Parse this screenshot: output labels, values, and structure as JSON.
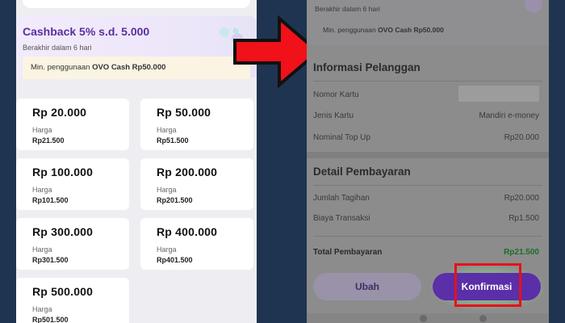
{
  "left": {
    "promo": {
      "title": "Cashback 5% s.d. 5.000",
      "subtitle": "Berakhir dalam 6 hari",
      "min_prefix": "Min. penggunaan ",
      "min_bold": "OVO Cash Rp50.000"
    },
    "price_label": "Harga",
    "denominations": [
      {
        "amount": "Rp 20.000",
        "price": "Rp21.500"
      },
      {
        "amount": "Rp 50.000",
        "price": "Rp51.500"
      },
      {
        "amount": "Rp 100.000",
        "price": "Rp101.500"
      },
      {
        "amount": "Rp 200.000",
        "price": "Rp201.500"
      },
      {
        "amount": "Rp 300.000",
        "price": "Rp301.500"
      },
      {
        "amount": "Rp 400.000",
        "price": "Rp401.500"
      },
      {
        "amount": "Rp 500.000",
        "price": "Rp501.500"
      }
    ]
  },
  "right": {
    "header": {
      "expiry": "Berakhir dalam 6 hari",
      "min_prefix": "Min. penggunaan ",
      "min_bold": "OVO Cash Rp50.000"
    },
    "customer": {
      "title": "Informasi Pelanggan",
      "card_number_label": "Nomor Kartu",
      "card_type_label": "Jenis Kartu",
      "card_type_value": "Mandiri e-money",
      "topup_label": "Nominal Top Up",
      "topup_value": "Rp20.000"
    },
    "payment": {
      "title": "Detail Pembayaran",
      "bill_label": "Jumlah Tagihan",
      "bill_value": "Rp20.000",
      "fee_label": "Biaya Transaksi",
      "fee_value": "Rp1.500",
      "total_label": "Total Pembayaran",
      "total_value": "Rp21.500"
    },
    "buttons": {
      "change": "Ubah",
      "confirm": "Konfirmasi"
    }
  },
  "colors": {
    "background": "#1f3450",
    "accent_purple": "#5a2fa8",
    "highlight_red": "#e8101a",
    "total_green": "#1d6e28"
  }
}
